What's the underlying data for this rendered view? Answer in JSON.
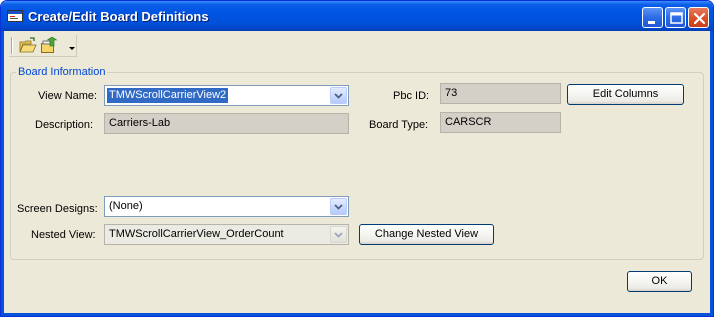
{
  "window": {
    "title": "Create/Edit Board Definitions"
  },
  "toolbar": {
    "open_icon": "open-folder-icon",
    "export_icon": "export-icon",
    "more_icon": "chevron-down-icon"
  },
  "group": {
    "title": "Board Information"
  },
  "form": {
    "view_name_label": "View Name:",
    "view_name_value": "TMWScrollCarrierView2",
    "description_label": "Description:",
    "description_value": "Carriers-Lab",
    "pbc_id_label": "Pbc ID:",
    "pbc_id_value": "73",
    "board_type_label": "Board Type:",
    "board_type_value": "CARSCR",
    "edit_columns_label": "Edit Columns",
    "screen_designs_label": "Screen Designs:",
    "screen_designs_value": "(None)",
    "nested_view_label": "Nested View:",
    "nested_view_value": "TMWScrollCarrierView_OrderCount",
    "change_nested_label": "Change Nested View"
  },
  "footer": {
    "ok_label": "OK"
  }
}
